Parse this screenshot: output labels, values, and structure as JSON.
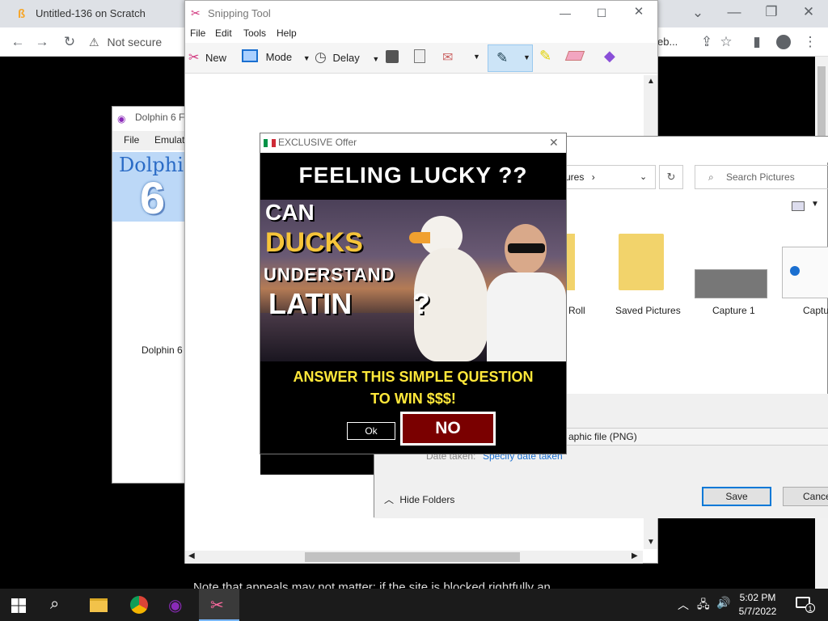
{
  "chrome": {
    "tab_title": "Untitled-136 on Scratch",
    "security_text": "Not secure",
    "url_fragment": "eb..."
  },
  "dolphin": {
    "title": "Dolphin 6 F",
    "menu": [
      "File",
      "Emulat"
    ],
    "banner_text": "Dolphi",
    "banner_digit": "6",
    "body_label": "Dolphin 6 F"
  },
  "snipping": {
    "title": "Snipping Tool",
    "menu": [
      "File",
      "Edit",
      "Tools",
      "Help"
    ],
    "new_label": "New",
    "mode_label": "Mode",
    "delay_label": "Delay"
  },
  "save_dialog": {
    "breadcrumb_tail": "ures",
    "search_placeholder": "Search Pictures",
    "folders": [
      "Roll",
      "Saved Pictures",
      "Capture 1",
      "Captu"
    ],
    "file_type": "aphic file (PNG)",
    "date_taken_label": "Date taken:",
    "date_taken_value": "Specify date taken",
    "hide_folders_label": "Hide Folders",
    "save_label": "Save",
    "cancel_label": "Cance"
  },
  "popup": {
    "title": "EXCLUSIVE Offer",
    "headline": "FEELING LUCKY ??",
    "image_lines": [
      "CAN",
      "DUCKS",
      "UNDERSTAND",
      "LATIN",
      "?"
    ],
    "question_line1": "ANSWER THIS SIMPLE QUESTION",
    "question_line2": "TO WIN $$$!",
    "ok_label": "Ok",
    "no_label": "NO"
  },
  "background_text": "Note that appeals may not matter; if the site is blocked rightfully an",
  "taskbar": {
    "time": "5:02 PM",
    "date": "5/7/2022",
    "notification_count": "1"
  },
  "colors": {
    "popup_no_bg": "#7a0000",
    "popup_question_yellow": "#ffe83a",
    "ducks_text_yellow": "#f6c43a",
    "accent_blue": "#0078d7"
  }
}
